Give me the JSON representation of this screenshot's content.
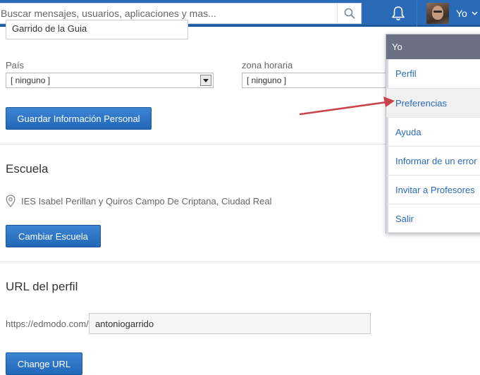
{
  "header": {
    "search_placeholder": "Buscar mensajes, usuarios, aplicaciones y mas...",
    "user_name": "Yo"
  },
  "form": {
    "name_value": "Garrido de la Guia",
    "country_label": "País",
    "country_value": "[ ninguno ]",
    "timezone_label": "zona horaria",
    "timezone_value": "[ ninguno ]",
    "save_button": "Guardar Información Personal"
  },
  "school": {
    "heading": "Escuela",
    "name": "IES Isabel Perillan y Quiros Campo De Criptana, Ciudad Real",
    "change_button": "Cambiar Escuela"
  },
  "profile_url": {
    "heading": "URL del perfil",
    "prefix": "https://edmodo.com/",
    "value": "antoniogarrido",
    "change_button": "Change URL"
  },
  "dropdown": {
    "title": "Yo",
    "items": [
      {
        "label": "Perfil"
      },
      {
        "label": "Preferencias"
      },
      {
        "label": "Ayuda"
      },
      {
        "label": "Informar de un error"
      },
      {
        "label": "Invitar a Profesores"
      },
      {
        "label": "Salir"
      }
    ]
  },
  "colors": {
    "brand": "#2a6bb7",
    "annotation_arrow": "#c9444a"
  }
}
